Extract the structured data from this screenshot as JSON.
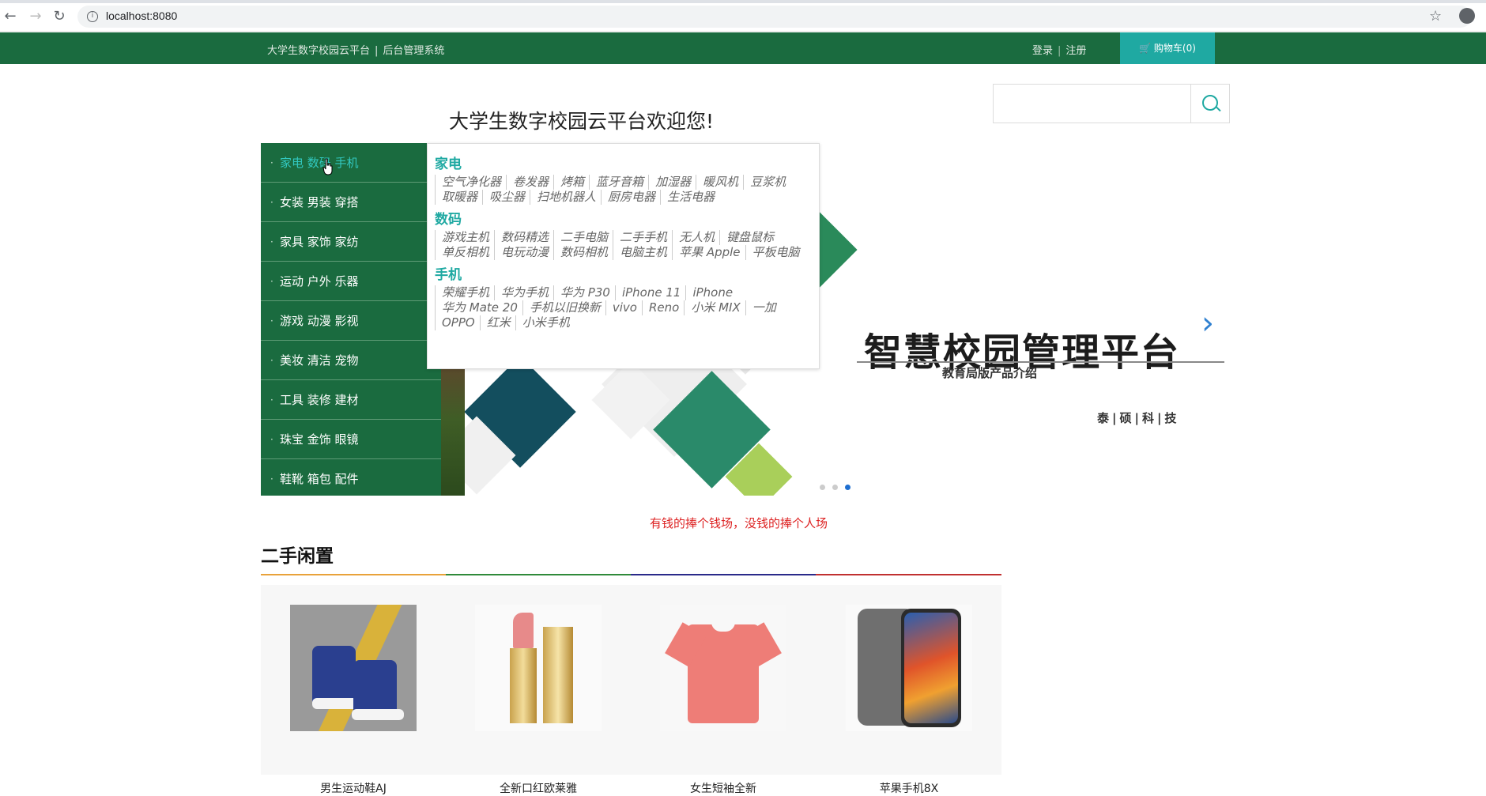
{
  "browser": {
    "url": "localhost:8080"
  },
  "topbar": {
    "site_name": "大学生数字校园云平台",
    "admin_link": "后台管理系统",
    "login": "登录",
    "register": "注册",
    "cart": "购物车(0)"
  },
  "header": {
    "welcome": "大学生数字校园云平台欢迎您!"
  },
  "categories": [
    "家电 数码 手机",
    "女装 男装 穿搭",
    "家具 家饰 家纺",
    "运动 户外 乐器",
    "游戏 动漫 影视",
    "美妆 清洁 宠物",
    "工具 装修 建材",
    "珠宝 金饰 眼镜",
    "鞋靴 箱包 配件"
  ],
  "dropdown": [
    {
      "title": "家电",
      "items": [
        "空气净化器",
        "卷发器",
        "烤箱",
        "蓝牙音箱",
        "加湿器",
        "暖风机",
        "豆浆机",
        "取暖器",
        "吸尘器",
        "扫地机器人",
        "厨房电器",
        "生活电器"
      ]
    },
    {
      "title": "数码",
      "items": [
        "游戏主机",
        "数码精选",
        "二手电脑",
        "二手手机",
        "无人机",
        "键盘鼠标",
        "单反相机",
        "电玩动漫",
        "数码相机",
        "电脑主机",
        "苹果 Apple",
        "平板电脑"
      ]
    },
    {
      "title": "手机",
      "items": [
        "荣耀手机",
        "华为手机",
        "华为 P30",
        "iPhone 11",
        "iPhone",
        "华为 Mate 20",
        "手机以旧换新",
        "vivo",
        "Reno",
        "小米 MIX",
        "一加",
        "OPPO",
        "红米",
        "小米手机"
      ]
    }
  ],
  "banner": {
    "title": "智慧校园管理平台",
    "subtitle": "教育局版产品介绍",
    "brand": "泰|硕|科|技",
    "slides": 3,
    "active_slide": 3
  },
  "slogan": "有钱的捧个钱场，没钱的捧个人场",
  "section": {
    "title": "二手闲置",
    "rule_colors": [
      "#e8a23a",
      "#2f8a3a",
      "#2a2a8a",
      "#c03030"
    ]
  },
  "products": [
    {
      "name": "男生运动鞋AJ",
      "icon": "sneaker-image"
    },
    {
      "name": "全新口红欧莱雅",
      "icon": "lipstick-image"
    },
    {
      "name": "女生短袖全新",
      "icon": "tshirt-image"
    },
    {
      "name": "苹果手机8X",
      "icon": "phone-image"
    }
  ]
}
